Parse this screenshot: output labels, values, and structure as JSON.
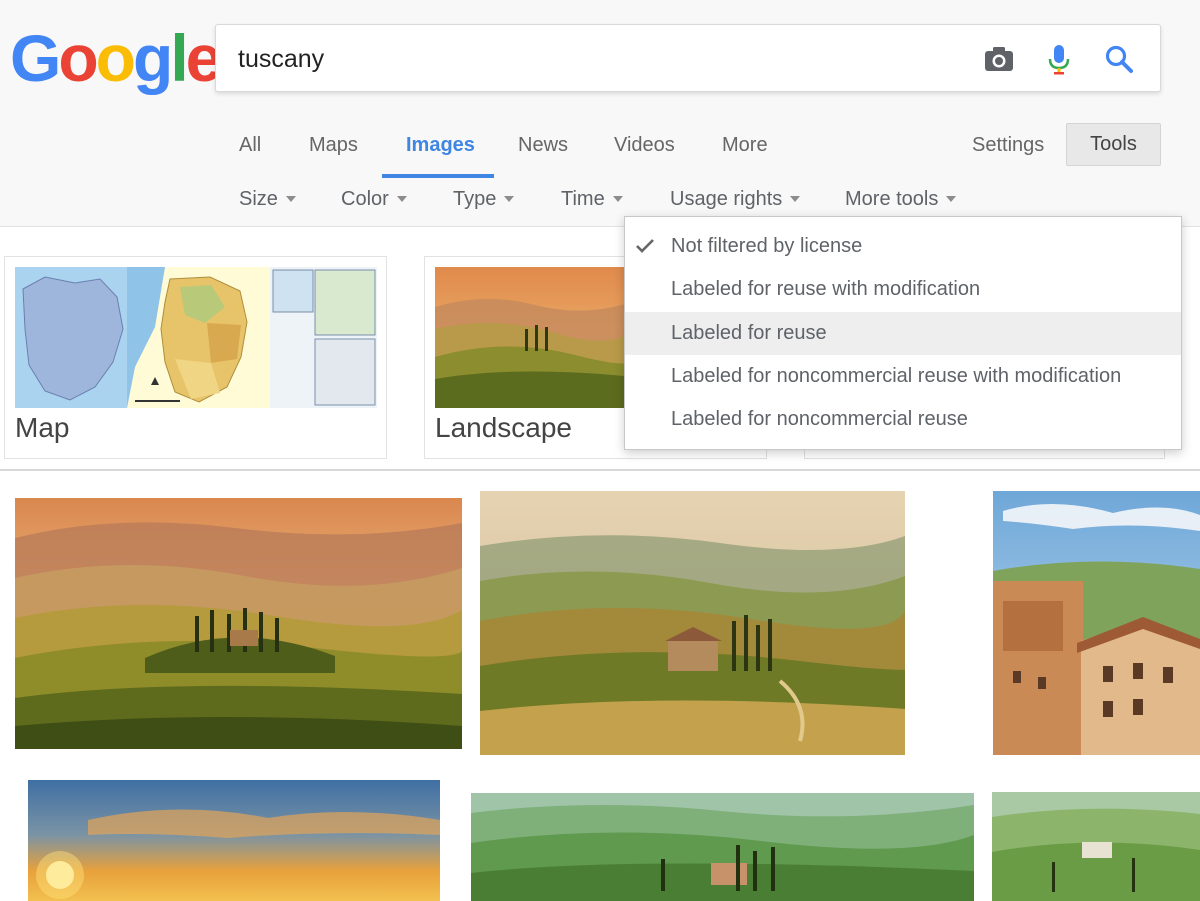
{
  "logo": {
    "letters": [
      "G",
      "o",
      "o",
      "g",
      "l",
      "e"
    ],
    "colors": [
      "#4285f4",
      "#ea4335",
      "#fbbc05",
      "#4285f4",
      "#34a853",
      "#ea4335"
    ]
  },
  "search": {
    "query": "tuscany"
  },
  "tabs": [
    {
      "label": "All"
    },
    {
      "label": "Maps"
    },
    {
      "label": "Images",
      "active": true
    },
    {
      "label": "News"
    },
    {
      "label": "Videos"
    },
    {
      "label": "More"
    }
  ],
  "settings_label": "Settings",
  "tools_label": "Tools",
  "filters": [
    {
      "label": "Size"
    },
    {
      "label": "Color"
    },
    {
      "label": "Type"
    },
    {
      "label": "Time"
    },
    {
      "label": "Usage rights"
    },
    {
      "label": "More tools"
    }
  ],
  "usage_rights_menu": {
    "items": [
      {
        "label": "Not filtered by license",
        "checked": true
      },
      {
        "label": "Labeled for reuse with modification"
      },
      {
        "label": "Labeled for reuse",
        "highlighted": true
      },
      {
        "label": "Labeled for noncommercial reuse with modification"
      },
      {
        "label": "Labeled for noncommercial reuse"
      }
    ]
  },
  "categories": [
    {
      "label": "Map"
    },
    {
      "label": "Landscape"
    }
  ],
  "colors": {
    "accent": "#3f85e3",
    "header_bg": "#f8f8f8"
  }
}
